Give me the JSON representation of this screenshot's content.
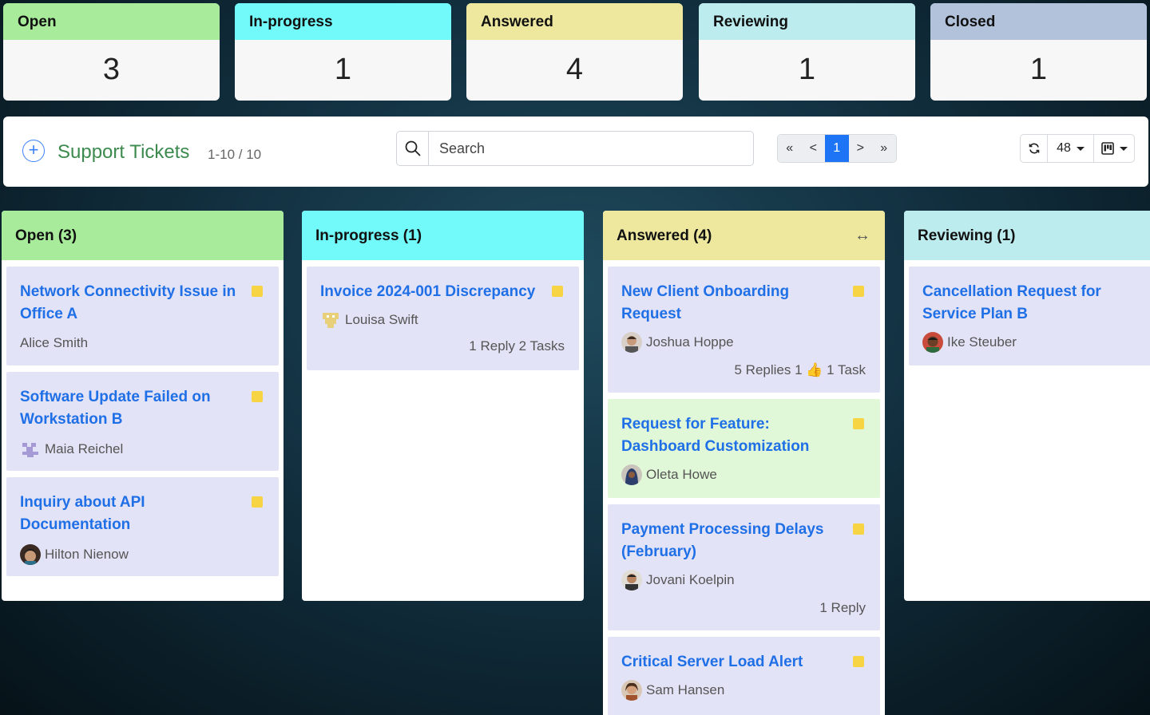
{
  "summary": [
    {
      "label": "Open",
      "count": "3",
      "color": "#a7eb9b"
    },
    {
      "label": "In-progress",
      "count": "1",
      "color": "#72fafb"
    },
    {
      "label": "Answered",
      "count": "4",
      "color": "#ede89e"
    },
    {
      "label": "Reviewing",
      "count": "1",
      "color": "#bcecee"
    },
    {
      "label": "Closed",
      "count": "1",
      "color": "#b2c2db"
    }
  ],
  "toolbar": {
    "title": "Support Tickets",
    "range": "1-10 / 10",
    "search_placeholder": "Search",
    "pager": [
      "«",
      "<",
      "1",
      ">",
      "»"
    ],
    "page_size": "48"
  },
  "columns": [
    {
      "title": "Open (3)",
      "color": "#a7eb9b",
      "cards": [
        {
          "title": "Network Connectivity Issue in Office A",
          "assignee": "Alice Smith"
        },
        {
          "title": "Software Update Failed on Workstation B",
          "assignee": "Maia Reichel"
        },
        {
          "title": "Inquiry about API Documentation",
          "assignee": "Hilton Nienow"
        }
      ]
    },
    {
      "title": "In-progress (1)",
      "color": "#72fafb",
      "cards": [
        {
          "title": "Invoice 2024-001 Discrepancy",
          "assignee": "Louisa Swift",
          "meta": "1 Reply 2 Tasks"
        }
      ]
    },
    {
      "title": "Answered (4)",
      "color": "#ede89e",
      "expand_icon": "↔",
      "cards": [
        {
          "title": "New Client Onboarding Request",
          "assignee": "Joshua Hoppe",
          "meta": "5 Replies 1 👍 1 Task"
        },
        {
          "title": "Request for Feature: Dashboard Customization",
          "assignee": "Oleta Howe",
          "highlight": "#e1f8d8"
        },
        {
          "title": "Payment Processing Delays (February)",
          "assignee": "Jovani Koelpin",
          "meta": "1 Reply"
        },
        {
          "title": "Critical Server Load Alert",
          "assignee": "Sam Hansen"
        }
      ]
    },
    {
      "title": "Reviewing (1)",
      "color": "#bcecee",
      "cards": [
        {
          "title": "Cancellation Request for Service Plan B",
          "assignee": "Ike Steuber"
        }
      ]
    }
  ]
}
